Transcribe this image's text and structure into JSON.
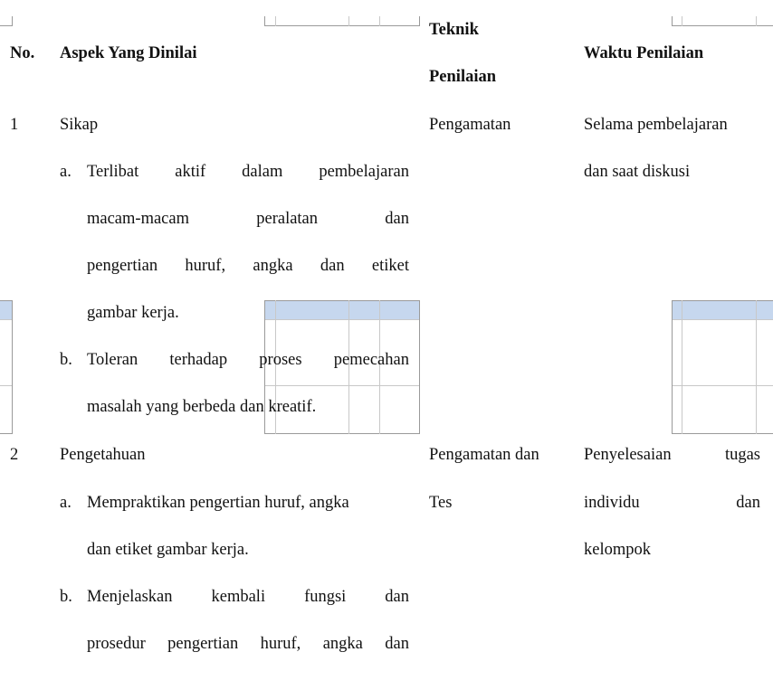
{
  "table": {
    "headers": {
      "no": "No.",
      "aspek": "Aspek Yang Dinilai",
      "teknik_line1": "Teknik",
      "teknik_line2": "Penilaian",
      "waktu": "Waktu Penilaian"
    },
    "rows": [
      {
        "no": "1",
        "aspek_title": "Sikap",
        "items": [
          {
            "marker": "a.",
            "lines": [
              [
                "Terlibat",
                "aktif",
                "dalam",
                "pembelajaran"
              ],
              [
                "macam-macam",
                "peralatan",
                "dan"
              ],
              [
                "pengertian",
                "huruf,",
                "angka",
                "dan",
                "etiket"
              ],
              [
                "gambar kerja."
              ]
            ]
          },
          {
            "marker": "b.",
            "lines": [
              [
                "Toleran",
                "terhadap",
                "proses",
                "pemecahan"
              ],
              [
                "masalah yang berbeda dan kreatif."
              ]
            ]
          }
        ],
        "teknik": [
          "Pengamatan"
        ],
        "waktu": [
          "Selama pembelajaran",
          "dan saat diskusi"
        ]
      },
      {
        "no": "2",
        "aspek_title": "Pengetahuan",
        "items": [
          {
            "marker": "a.",
            "lines": [
              [
                "Mempraktikan pengertian huruf, angka"
              ],
              [
                "dan etiket gambar kerja."
              ]
            ]
          },
          {
            "marker": "b.",
            "lines": [
              [
                "Menjelaskan",
                "kembali",
                "fungsi",
                "dan"
              ],
              [
                "prosedur",
                "pengertian",
                "huruf,",
                "angka",
                "dan"
              ]
            ]
          }
        ],
        "teknik": [
          "Pengamatan dan",
          "Tes"
        ],
        "waktu": [
          [
            "Penyelesaian",
            "tugas"
          ],
          [
            "individu",
            "dan"
          ],
          [
            "kelompok"
          ]
        ]
      }
    ]
  },
  "colors": {
    "ghost_header_fill": "#c6d7ee",
    "ghost_border": "#9a9a9a"
  }
}
